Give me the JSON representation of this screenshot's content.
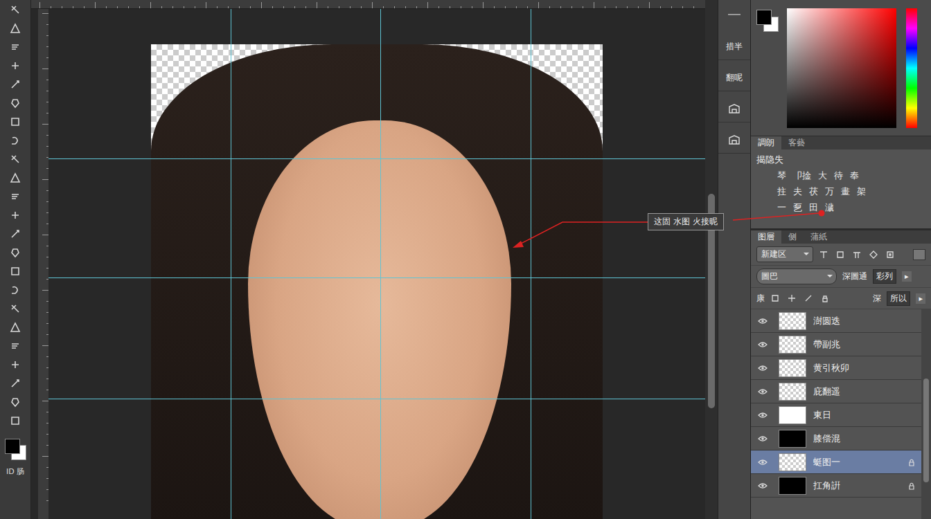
{
  "swatches": {
    "foreground": "#000000",
    "background": "#ffffff"
  },
  "toolbar": {
    "bottom_label": "ID 肠"
  },
  "dock": [
    {
      "kind": "label",
      "label": "措半"
    },
    {
      "kind": "label",
      "label": "翻呢"
    },
    {
      "kind": "icon",
      "label": ""
    },
    {
      "kind": "icon",
      "label": ""
    }
  ],
  "adjustments_panel": {
    "tabs": [
      {
        "label": "調朗",
        "selected": true
      },
      {
        "label": "客藝",
        "selected": false
      }
    ],
    "title": "揭隐失",
    "rows": [
      [
        "琴",
        "卩捦",
        "大",
        "待",
        "奉"
      ],
      [
        "拄",
        "夫",
        "茯",
        "万",
        "畫",
        "架"
      ],
      [
        "一",
        "乭",
        "田",
        "濊"
      ]
    ]
  },
  "callout": {
    "text": "这固 水图 火接昵"
  },
  "layers_panel": {
    "tabs": [
      {
        "label": "图層",
        "selected": true
      },
      {
        "label": "侧",
        "selected": false
      },
      {
        "label": "蒲紙",
        "selected": false
      }
    ],
    "filter": "新建区",
    "blend_mode": "圖巴",
    "opacity_label": "深圖通",
    "opacity": "彩列",
    "arrow": "▸",
    "lock_label": "康",
    "fill_label": "深",
    "fill": "所以",
    "layers": [
      {
        "name": "澍圆迭",
        "thumb": "transparent",
        "visible": true,
        "selected": false,
        "locked": false
      },
      {
        "name": "帶副兆",
        "thumb": "transparent",
        "visible": true,
        "selected": false,
        "locked": false
      },
      {
        "name": "黄引秋卯",
        "thumb": "transparent",
        "visible": true,
        "selected": false,
        "locked": false
      },
      {
        "name": "庇翻遥",
        "thumb": "transparent",
        "visible": true,
        "selected": false,
        "locked": false
      },
      {
        "name": "東日",
        "thumb": "white",
        "visible": true,
        "selected": false,
        "locked": false
      },
      {
        "name": "膝偿混",
        "thumb": "black",
        "visible": true,
        "selected": false,
        "locked": false
      },
      {
        "name": "蜓图一",
        "thumb": "transparent",
        "visible": true,
        "selected": true,
        "locked": true
      },
      {
        "name": "扛角詽",
        "thumb": "black",
        "visible": true,
        "selected": false,
        "locked": true
      }
    ]
  }
}
